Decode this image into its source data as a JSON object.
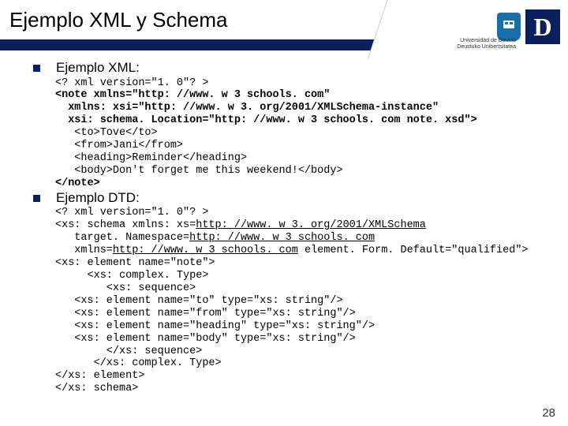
{
  "header": {
    "title": "Ejemplo XML y Schema",
    "logo_text_line1": "Universidad de Deusto",
    "logo_text_line2": "Deustuko Unibertsitatea",
    "logo_letter": "D"
  },
  "bullets": {
    "xml_label": "Ejemplo XML:",
    "dtd_label": "Ejemplo DTD:"
  },
  "code_xml": {
    "l1": "<? xml version=\"1. 0\"? >",
    "l2": "<note xmlns=\"http: //www. w 3 schools. com\"",
    "l3": "  xmlns: xsi=\"http: //www. w 3. org/2001/XMLSchema-instance\"",
    "l4": "  xsi: schema. Location=\"http: //www. w 3 schools. com note. xsd\">",
    "l5": "   <to>Tove</to>",
    "l6": "   <from>Jani</from>",
    "l7": "   <heading>Reminder</heading>",
    "l8": "   <body>Don't forget me this weekend!</body>",
    "l9": "</note>"
  },
  "code_dtd": {
    "l1": "<? xml version=\"1. 0\"? >",
    "l2a": "<xs: schema xmlns: xs=",
    "l2b": "http: //www. w 3. org/2001/XMLSchema",
    "l3a": "   target. Namespace=",
    "l3b": "http: //www. w 3 schools. com",
    "l4a": "   xmlns=",
    "l4b": "http: //www. w 3 schools. com",
    "l4c": " element. Form. Default=\"qualified\">",
    "l5": "<xs: element name=\"note\">",
    "l6": "     <xs: complex. Type>",
    "l7": "        <xs: sequence>",
    "l8": "   <xs: element name=\"to\" type=\"xs: string\"/>",
    "l9": "   <xs: element name=\"from\" type=\"xs: string\"/>",
    "l10": "   <xs: element name=\"heading\" type=\"xs: string\"/>",
    "l11": "   <xs: element name=\"body\" type=\"xs: string\"/>",
    "l12": "        </xs: sequence>",
    "l13": "      </xs: complex. Type>",
    "l14": "</xs: element>",
    "l15": "</xs: schema>"
  },
  "page_number": "28"
}
